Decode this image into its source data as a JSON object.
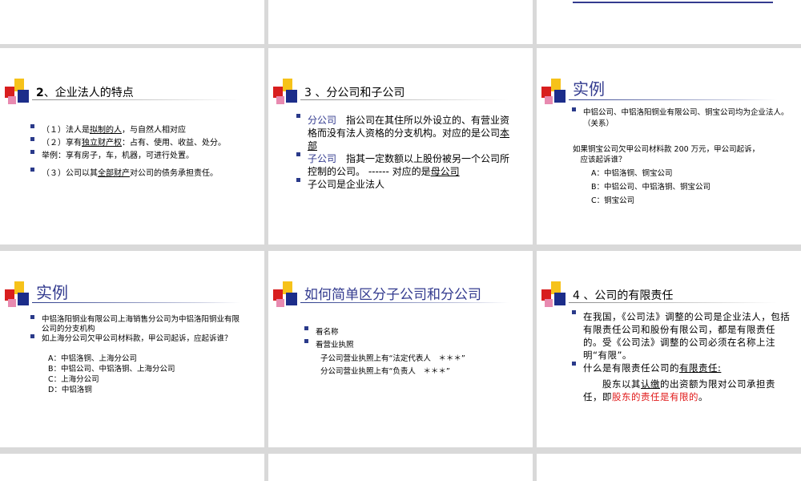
{
  "slide2": {
    "title_num": "2",
    "title_text": "、企业法人的特点",
    "items": [
      {
        "a": "（１）法人是",
        "b": "拟制的人",
        "c": "，与自然人相对应"
      },
      {
        "a": "（２）享有",
        "b": "独立财产权",
        "c": "：占有、使用、收益、处分。"
      },
      {
        "a": "举例：享有房子，车，机器，可进行处置。"
      },
      {
        "a": "（３）公司以其",
        "b": "全部财产",
        "c": "对公司的债务承担责任。"
      }
    ]
  },
  "slide3": {
    "title": "3 、分公司和子公司",
    "item1_term": "分公司",
    "item1_text": "　指公司在其住所以外设立的、有营业资格而没有法人资格的分支机构。对应的是公司",
    "item1_u": "本部",
    "item2_term": "子公司",
    "item2_text": "指其一定数额以上股份被另一个公司所控制的公司。 ------ 对应的是",
    "item2_u": "母公司",
    "item3": "子公司是企业法人"
  },
  "slide_ex1": {
    "title": "实例",
    "bullet": "中铝公司、中铝洛阳铜业有限公司、铜宝公司均为企业法人。（关系）",
    "question": "如果铜宝公司欠甲公司材料款 200 万元，甲公司起诉，\n　应该起诉谁？",
    "options": [
      "A：中铝洛铜、铜宝公司",
      "B：中铝公司、中铝洛铜、铜宝公司",
      "C：铜宝公司"
    ]
  },
  "slide_ex2": {
    "title": "实例",
    "bullets": [
      "中铝洛阳铜业有限公司上海销售分公司为中铝洛阳铜业有限公司的分支机构",
      "如上海分公司欠甲公司材料款，甲公司起诉，应起诉谁？"
    ],
    "options": [
      "A：中铝洛铜、上海分公司",
      "B：中铝公司、中铝洛铜、上海分公司",
      "C：上海分公司",
      "D：中铝洛铜"
    ]
  },
  "slide_dist": {
    "title": "如何简单区分子公司和分公司",
    "bullets": [
      "看名称",
      "看营业执照"
    ],
    "lines": [
      "子公司营业执照上有“法定代表人　＊＊＊”",
      "分公司营业执照上有“负责人　＊＊＊”"
    ]
  },
  "slide4": {
    "title": "4 、公司的有限责任",
    "bullet1": "在我国，《公司法》调整的公司是企业法人，包括有限责任公司和股份有限公司，都是有限责任的。受《公司法》调整的公司必须在名称上注明“有限”。",
    "bullet2_a": "什么是有限责任公司的",
    "bullet2_u": "有限责任:",
    "para_a": "　　股东以其",
    "para_u": "认缴",
    "para_b": "的出资额为限对公司承担责任，即",
    "para_red": "股东的责任是有限的",
    "para_end": "。"
  }
}
